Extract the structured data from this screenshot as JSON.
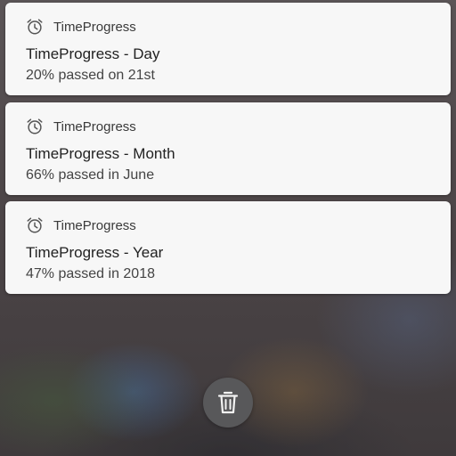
{
  "notifications": [
    {
      "app_name": "TimeProgress",
      "title": "TimeProgress - Day",
      "text": "20% passed on 21st",
      "icon": "alarm-clock-icon"
    },
    {
      "app_name": "TimeProgress",
      "title": "TimeProgress - Month",
      "text": "66% passed in June",
      "icon": "alarm-clock-icon"
    },
    {
      "app_name": "TimeProgress",
      "title": "TimeProgress - Year",
      "text": "47% passed in 2018",
      "icon": "alarm-clock-icon"
    }
  ],
  "clear_all": {
    "icon": "trash-icon"
  },
  "colors": {
    "card": "#f7f7f7",
    "button": "#58585a"
  }
}
